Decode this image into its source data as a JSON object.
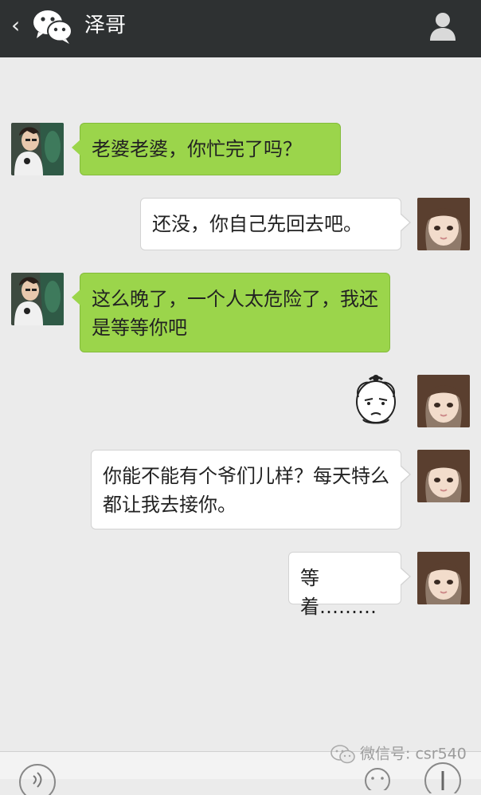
{
  "header": {
    "back_glyph": "‹",
    "title": "泽哥"
  },
  "messages": [
    {
      "side": "left",
      "text": "老婆老婆，你忙完了吗？"
    },
    {
      "side": "right",
      "text": "还没，你自己先回去吧。"
    },
    {
      "side": "left",
      "text": "这么晚了，一个人太危险了，我还是等等你吧"
    },
    {
      "side": "right",
      "type": "sticker",
      "sticker": "bald-man-face-sticker"
    },
    {
      "side": "right",
      "text": "你能不能有个爷们儿样？每天特么都让我去接你。"
    },
    {
      "side": "right",
      "text": "等着………"
    }
  ],
  "watermark": {
    "text": "微信号: csr540"
  },
  "colors": {
    "topbar": "#2e3132",
    "background": "#ebebeb",
    "sent_bubble": "#ffffff",
    "received_bubble": "#9bd54b"
  }
}
